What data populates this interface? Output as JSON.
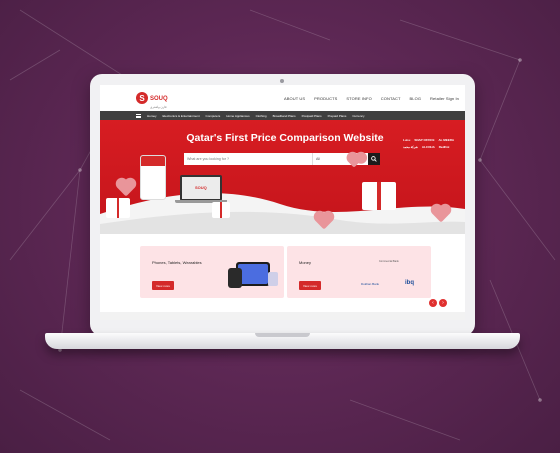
{
  "header": {
    "logo_letter": "S",
    "logo_name": "SOUQ",
    "logo_sub": "قارن واشتري",
    "nav": [
      "ABOUT US",
      "PRODUCTS",
      "STORE INFO",
      "CONTACT",
      "BLOG",
      "Retailer Sign In"
    ]
  },
  "categories": [
    "Homey",
    "Electronics & Entertainment",
    "Computers",
    "Home Appliances",
    "Clothing",
    "Broadband Plans",
    "Postpaid Plans",
    "Prepaid Plans",
    "Currency"
  ],
  "hero": {
    "title": "Qatar's First Price Comparison Website",
    "search_placeholder": "What are you looking for ?",
    "search_select": "All",
    "sponsors": [
      "LuLu",
      "SNAP OFFICE",
      "AL MEERA",
      "شركة محمد",
      "ALCOHA",
      "RedDot"
    ]
  },
  "cards": [
    {
      "title": "Phones, Tablets, Wearables",
      "button": "View more"
    },
    {
      "title": "Money",
      "button": "View more",
      "brands": [
        "Commercial Bank",
        "Dukhan Bank",
        "ibq"
      ]
    }
  ],
  "colors": {
    "brand": "#d42a2a",
    "background": "#5a2650"
  },
  "icons": [
    "search-icon",
    "menu-icon",
    "chevron-left-icon",
    "chevron-right-icon"
  ]
}
